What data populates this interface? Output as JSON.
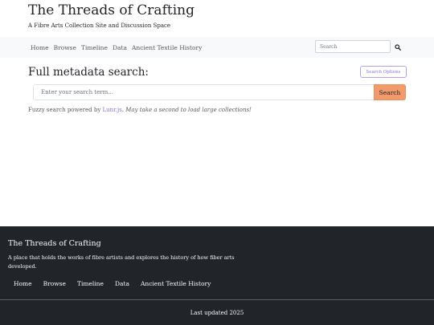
{
  "header": {
    "title": "The Threads of Crafting",
    "tagline": "A Fibre Arts Collection Site and Discussion Space"
  },
  "nav": {
    "items": [
      {
        "label": "Home"
      },
      {
        "label": "Browse"
      },
      {
        "label": "Timeline"
      },
      {
        "label": "Data"
      },
      {
        "label": "Ancient Textile History"
      }
    ],
    "search_placeholder": "Search",
    "search_icon": "search-icon"
  },
  "main": {
    "heading": "Full metadata search:",
    "search_options_label": "Search Options",
    "search_placeholder": "Enter your search term...",
    "search_button_label": "Search",
    "note_prefix": "Fuzzy search powered by ",
    "note_link": "Lunr.js",
    "note_period": ".",
    "note_italic": " May take a second to load large collections!"
  },
  "footer": {
    "title": "The Threads of Crafting",
    "description": "A place that holds the works of fibre artists and explores the history of how fiber arts developed.",
    "nav": [
      {
        "label": "Home"
      },
      {
        "label": "Browse"
      },
      {
        "label": "Timeline"
      },
      {
        "label": "Data"
      },
      {
        "label": "Ancient Textile History"
      }
    ],
    "updated": "Last updated 2025"
  },
  "colors": {
    "accent_button": "#f29a6b",
    "link": "#8c6fdb",
    "footer_bg": "#212529",
    "navbar_bg": "#f8f9fa"
  }
}
